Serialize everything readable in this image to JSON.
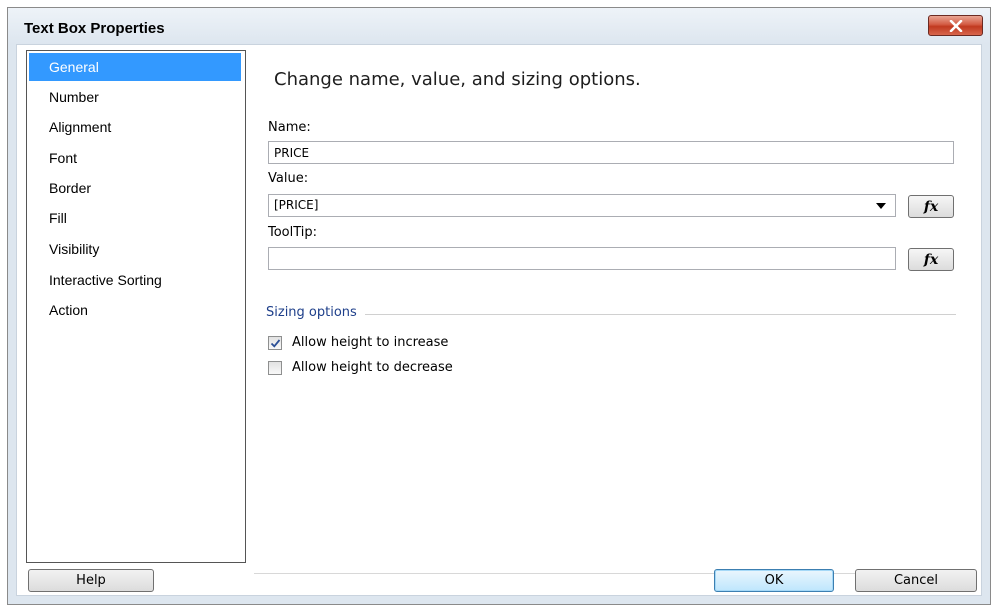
{
  "window": {
    "title": "Text Box Properties",
    "close_icon": "close-x-icon"
  },
  "nav": {
    "items": [
      {
        "label": "General",
        "selected": true
      },
      {
        "label": "Number",
        "selected": false
      },
      {
        "label": "Alignment",
        "selected": false
      },
      {
        "label": "Font",
        "selected": false
      },
      {
        "label": "Border",
        "selected": false
      },
      {
        "label": "Fill",
        "selected": false
      },
      {
        "label": "Visibility",
        "selected": false
      },
      {
        "label": "Interactive Sorting",
        "selected": false
      },
      {
        "label": "Action",
        "selected": false
      }
    ]
  },
  "main": {
    "heading": "Change name, value, and sizing options.",
    "name_label": "Name:",
    "name_value": "PRICE",
    "value_label": "Value:",
    "value_value": "[PRICE]",
    "tooltip_label": "ToolTip:",
    "tooltip_value": "",
    "fx_label": "fx",
    "sizing_label": "Sizing options",
    "allow_increase_label": "Allow height to increase",
    "allow_increase_checked": true,
    "allow_decrease_label": "Allow height to decrease",
    "allow_decrease_checked": false
  },
  "footer": {
    "help_label": "Help",
    "ok_label": "OK",
    "cancel_label": "Cancel"
  },
  "colors": {
    "selection": "#3399ff",
    "section_text": "#1e3f8a",
    "close_button": "#c0391f"
  }
}
